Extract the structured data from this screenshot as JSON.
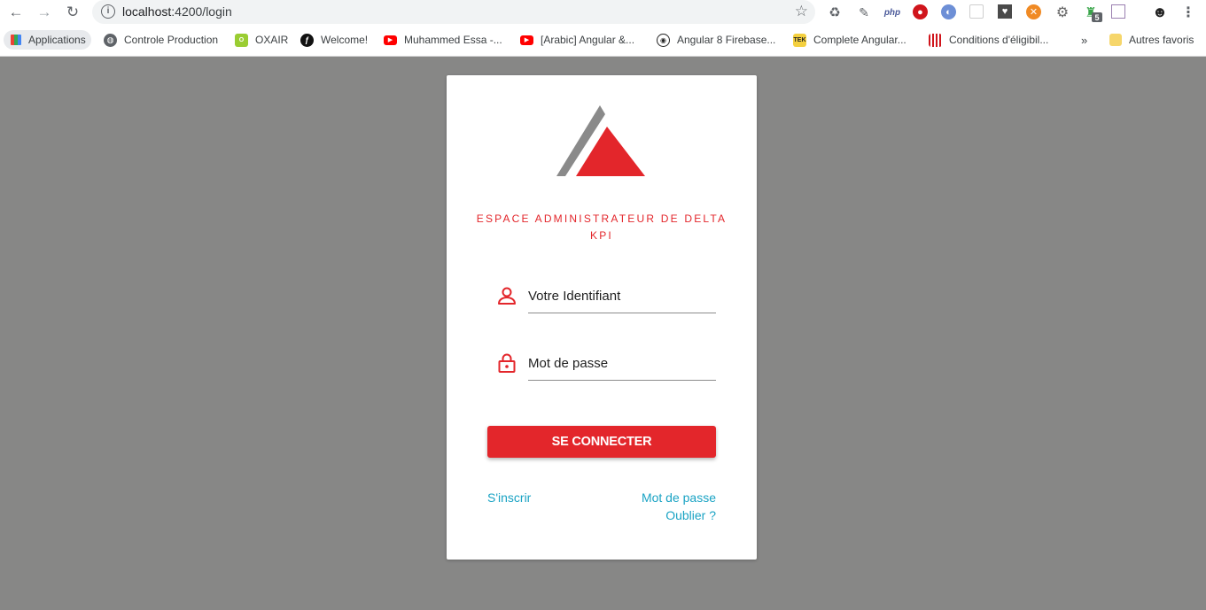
{
  "browser": {
    "url_host": "localhost",
    "url_path": ":4200/login",
    "bookmarks": [
      {
        "label": "Applications",
        "icon": "apps-grid-icon"
      },
      {
        "label": "Controle Production",
        "icon": "globe-icon"
      },
      {
        "label": "OXAIR",
        "icon": "oxair-icon"
      },
      {
        "label": "Welcome!",
        "icon": "symfony-icon"
      },
      {
        "label": "Muhammed Essa -...",
        "icon": "youtube-icon"
      },
      {
        "label": "[Arabic] Angular &...",
        "icon": "youtube-icon"
      },
      {
        "label": "Angular 8 Firebase...",
        "icon": "github-icon"
      },
      {
        "label": "Complete Angular...",
        "icon": "tek-icon"
      },
      {
        "label": "Conditions d'éligibil...",
        "icon": "bars-icon"
      }
    ],
    "more_bookmarks": "»",
    "other_bookmarks": "Autres favoris",
    "extension_badge": "5",
    "php_ext_label": "php",
    "tek_label": "TEK"
  },
  "login": {
    "title": "ESPACE ADMINISTRATEUR DE DELTA KPI",
    "username_placeholder": "Votre Identifiant",
    "password_placeholder": "Mot de passe",
    "submit_label": "SE CONNECTER",
    "signup_link": "S'inscrir",
    "forgot_link_line1": "Mot de passe",
    "forgot_link_line2": "Oublier ?"
  },
  "colors": {
    "accent_red": "#e3262b",
    "link_blue": "#1aa3c4",
    "backdrop_gray": "#878786",
    "logo_gray": "#8a8a8a"
  }
}
